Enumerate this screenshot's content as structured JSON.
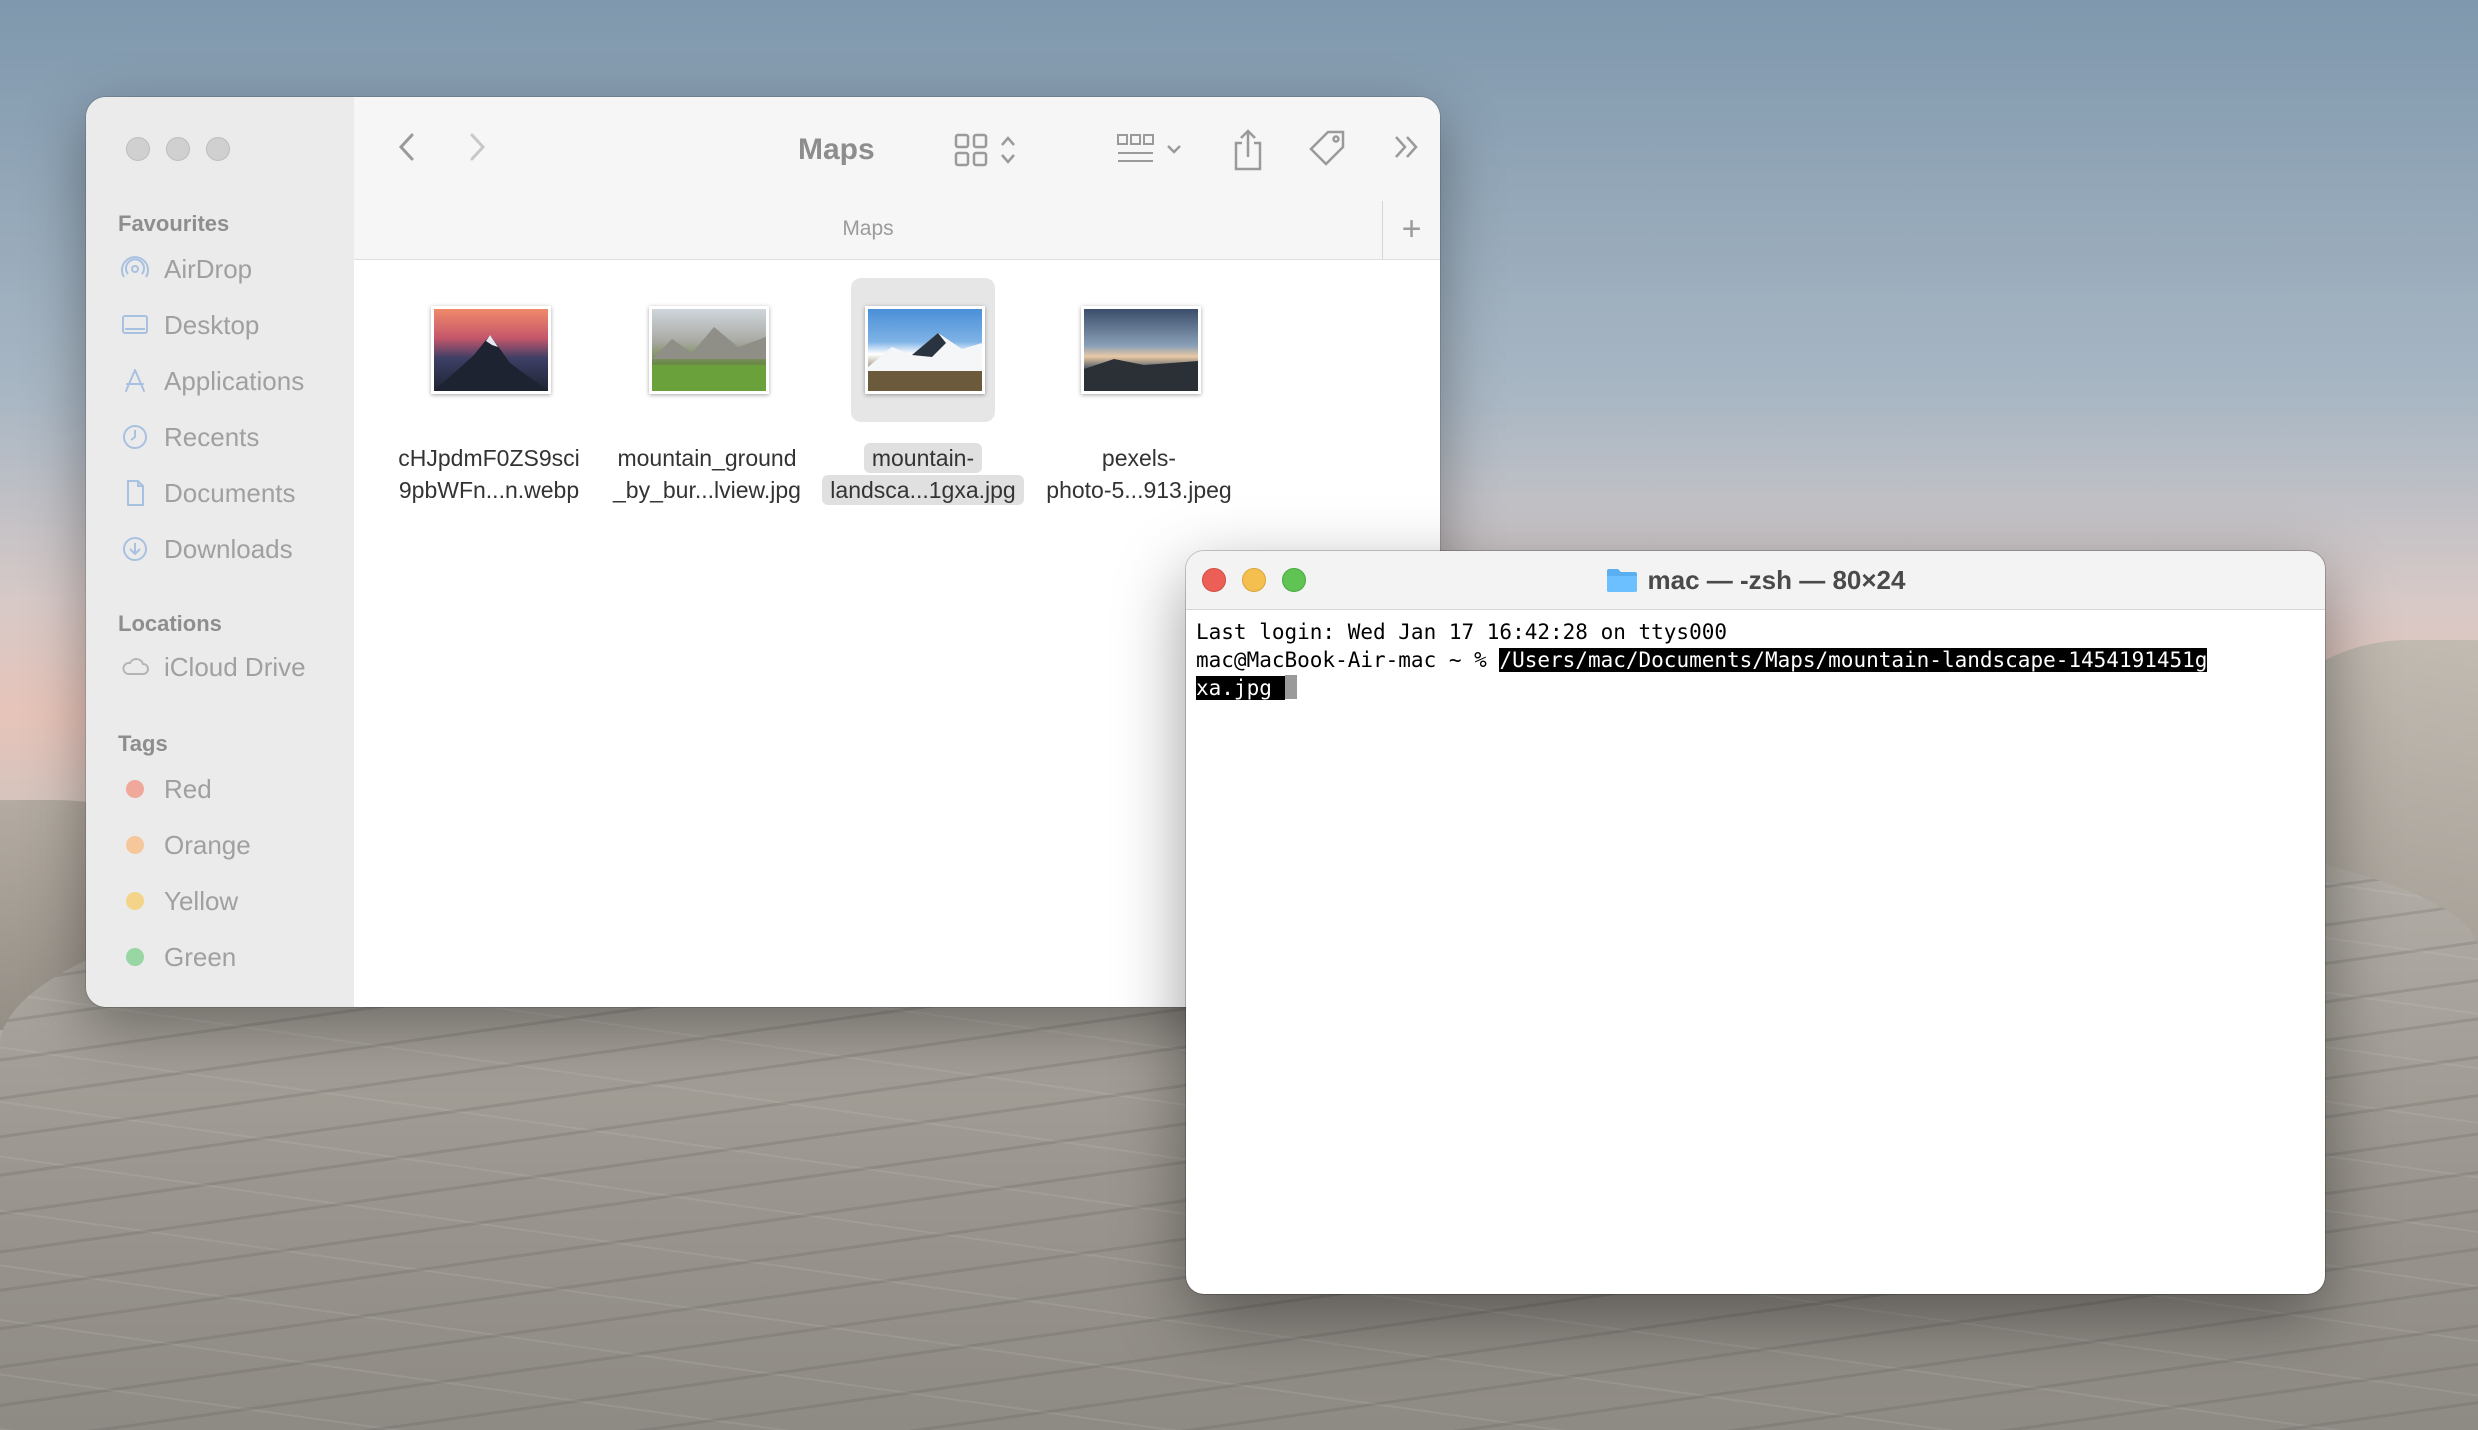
{
  "finder": {
    "title": "Maps",
    "path_label": "Maps",
    "add_label": "+",
    "sidebar": {
      "favourites_heading": "Favourites",
      "favourites": [
        {
          "label": "AirDrop",
          "icon": "airdrop-icon"
        },
        {
          "label": "Desktop",
          "icon": "desktop-icon"
        },
        {
          "label": "Applications",
          "icon": "applications-icon"
        },
        {
          "label": "Recents",
          "icon": "clock-icon"
        },
        {
          "label": "Documents",
          "icon": "document-icon"
        },
        {
          "label": "Downloads",
          "icon": "download-icon"
        }
      ],
      "locations_heading": "Locations",
      "locations": [
        {
          "label": "iCloud Drive",
          "icon": "cloud-icon"
        }
      ],
      "tags_heading": "Tags",
      "tags": [
        {
          "label": "Red",
          "color": "#f0a89a"
        },
        {
          "label": "Orange",
          "color": "#f5c79a"
        },
        {
          "label": "Yellow",
          "color": "#f4d488"
        },
        {
          "label": "Green",
          "color": "#98d6a3"
        }
      ]
    },
    "files": [
      {
        "line1": "cHJpdmF0ZS9sci",
        "line2": "9pbWFn...n.webp",
        "selected": false
      },
      {
        "line1": "mountain_ground",
        "line2": "_by_bur...lview.jpg",
        "selected": false
      },
      {
        "line1": "mountain-",
        "line2": "landsca...1gxa.jpg",
        "selected": true
      },
      {
        "line1": "pexels-",
        "line2": "photo-5...913.jpeg",
        "selected": false
      }
    ]
  },
  "terminal": {
    "title": "mac — -zsh — 80×24",
    "lines": {
      "last_login": "Last login: Wed Jan 17 16:42:28 on ttys000",
      "prompt": "mac@MacBook-Air-mac ~ % ",
      "command_part1": "/Users/mac/Documents/Maps/mountain-landscape-1454191451g",
      "command_part2": "xa.jpg "
    },
    "colors": {
      "close": "#ec5f57",
      "minimize": "#f5bf4f",
      "zoom": "#5fc454"
    }
  }
}
